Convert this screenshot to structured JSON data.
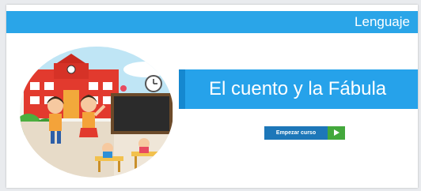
{
  "header": {
    "section_label": "Lenguaje"
  },
  "course": {
    "title": "El cuento y la Fábula",
    "start_button_label": "Empezar curso",
    "start_icon": "play-arrow-icon"
  },
  "illustration": {
    "subject": "school-children-illustration"
  },
  "colors": {
    "header_blue": "#2aa5e8",
    "title_blue": "#26a2ea",
    "button_blue": "#1d77b9",
    "button_green": "#43a83c"
  }
}
